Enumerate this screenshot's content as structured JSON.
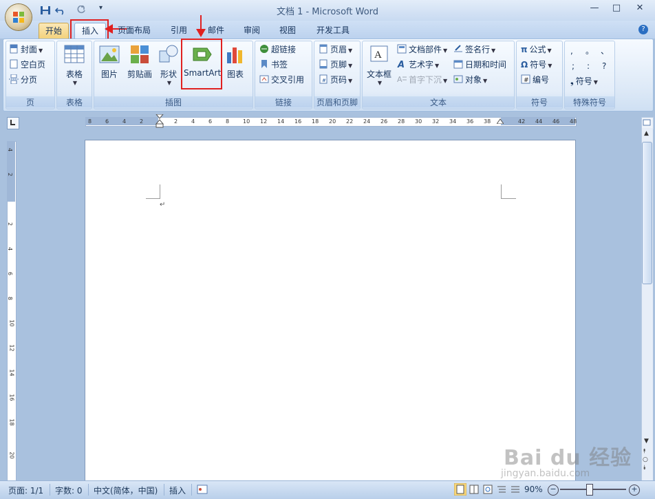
{
  "window": {
    "title": "文档 1 - Microsoft Word",
    "controls": {
      "minimize": "—",
      "maximize": "□",
      "close": "✕"
    }
  },
  "tabs": [
    {
      "label": "开始"
    },
    {
      "label": "插入"
    },
    {
      "label": "页面布局"
    },
    {
      "label": "引用"
    },
    {
      "label": "邮件"
    },
    {
      "label": "审阅"
    },
    {
      "label": "视图"
    },
    {
      "label": "开发工具"
    }
  ],
  "ribbon": {
    "pages": {
      "label": "页",
      "cover": "封面",
      "blank": "空白页",
      "break": "分页"
    },
    "tables": {
      "label": "表格",
      "table": "表格"
    },
    "illustrations": {
      "label": "插图",
      "picture": "图片",
      "clipart": "剪贴画",
      "shapes": "形状",
      "smartart": "SmartArt",
      "chart": "图表"
    },
    "links": {
      "label": "链接",
      "hyperlink": "超链接",
      "bookmark": "书签",
      "crossref": "交叉引用"
    },
    "headerfooter": {
      "label": "页眉和页脚",
      "header": "页眉",
      "footer": "页脚",
      "pagenum": "页码"
    },
    "text": {
      "label": "文本",
      "textbox": "文本框",
      "quickparts": "文档部件",
      "wordart": "艺术字",
      "dropcap": "首字下沉",
      "signature": "签名行",
      "datetime": "日期和时间",
      "object": "对象"
    },
    "symbols": {
      "label": "符号",
      "equation": "公式",
      "symbol": "符号",
      "number": "编号"
    },
    "special": {
      "label": "特殊符号",
      "symbol": "符号",
      "chars": [
        ",",
        "。",
        "、",
        ";",
        ":",
        "?"
      ]
    }
  },
  "ruler": {
    "h_ticks": [
      "8",
      "6",
      "4",
      "2",
      "2",
      "4",
      "6",
      "8",
      "10",
      "12",
      "14",
      "16",
      "18",
      "20",
      "22",
      "24",
      "26",
      "28",
      "30",
      "32",
      "34",
      "36",
      "38",
      "42",
      "44",
      "46",
      "48"
    ],
    "v_ticks": [
      "4",
      "2",
      "2",
      "4",
      "6",
      "8",
      "10",
      "12",
      "14",
      "16",
      "18",
      "20"
    ]
  },
  "document": {
    "paragraph_mark": "↵"
  },
  "status": {
    "page": "页面: 1/1",
    "words": "字数: 0",
    "language": "中文(简体，中国)",
    "mode": "插入",
    "zoom": "90%"
  },
  "watermark": {
    "brand": "Bai du 经验",
    "url": "jingyan.baidu.com"
  },
  "colors": {
    "highlight": "#e02020",
    "ribbon_bg": "#dde9f7",
    "frame": "#a9c1de"
  }
}
